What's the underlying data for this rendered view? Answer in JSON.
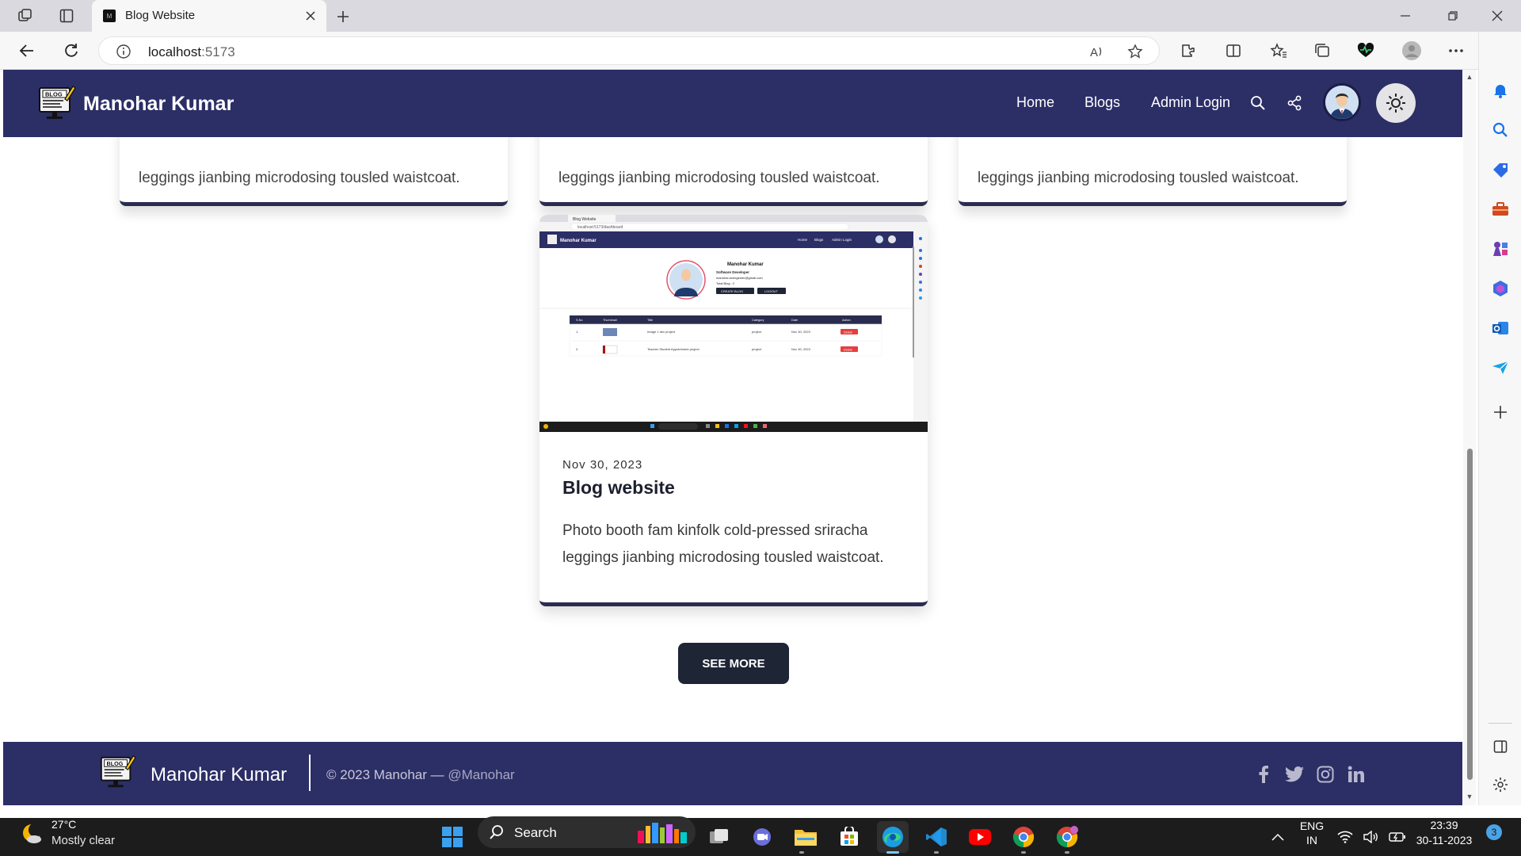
{
  "browser": {
    "tab_title": "Blog Website",
    "url_host": "localhost",
    "url_port": ":5173"
  },
  "site": {
    "brand": "Manohar Kumar",
    "nav": [
      "Home",
      "Blogs",
      "Admin Login"
    ],
    "logo_text": "BLOG"
  },
  "cards_top": {
    "peek_text": "leggings jianbing microdosing tousled waistcoat."
  },
  "blog_card": {
    "date": "Nov 30, 2023",
    "title": "Blog website",
    "description": "Photo booth fam kinfolk cold-pressed sriracha leggings jianbing microdosing tousled waistcoat.",
    "thumbnail": {
      "tab": "Blog Website",
      "url": "localhost:5173/dashboard",
      "brand": "Manohar Kumar",
      "nav": [
        "Home",
        "Blogs",
        "Admin Login"
      ],
      "profile_name": "Manohar Kumar",
      "profile_role": "Software Developer",
      "profile_email": "manohar.avengineer@gmail.com",
      "profile_total": "Total Blog : 2",
      "btn_create": "CREATE BLOG",
      "btn_logout": "LOGOUT",
      "table_headers": [
        "S.No",
        "Thumbnail",
        "Title",
        "Category",
        "Date",
        "Action"
      ],
      "rows": [
        {
          "no": "1.",
          "title": "Image 1 dev project",
          "category": "project",
          "date": "Nov 30, 2023",
          "action": "Delete"
        },
        {
          "no": "2.",
          "title": "Teacher Student Appointment project",
          "category": "project",
          "date": "Nov 30, 2023",
          "action": "Delete"
        }
      ]
    }
  },
  "see_more_label": "SEE MORE",
  "footer": {
    "brand": "Manohar Kumar",
    "copyright": "© 2023 Manohar — ",
    "handle": "@Manohar"
  },
  "taskbar": {
    "temperature": "27°C",
    "condition": "Mostly clear",
    "search": "Search",
    "lang_top": "ENG",
    "lang_bottom": "IN",
    "time": "23:39",
    "date": "30-11-2023",
    "notifications": "3"
  },
  "colors": {
    "header": "#2c2e66",
    "card_border": "#2a2c4f",
    "button": "#1e2535",
    "delete": "#e53e3e"
  },
  "icons": [
    "workspaces-icon",
    "tab-actions-icon",
    "back-icon",
    "refresh-icon",
    "info-icon",
    "read-aloud-icon",
    "favorite-icon",
    "extensions-icon",
    "split-screen-icon",
    "favorites-icon",
    "collections-icon",
    "copilot-icon",
    "search-icon",
    "share-icon",
    "sun-icon",
    "facebook-icon",
    "twitter-icon",
    "instagram-icon",
    "linkedin-icon",
    "windows-start-icon",
    "wifi-icon",
    "volume-icon",
    "battery-icon"
  ]
}
